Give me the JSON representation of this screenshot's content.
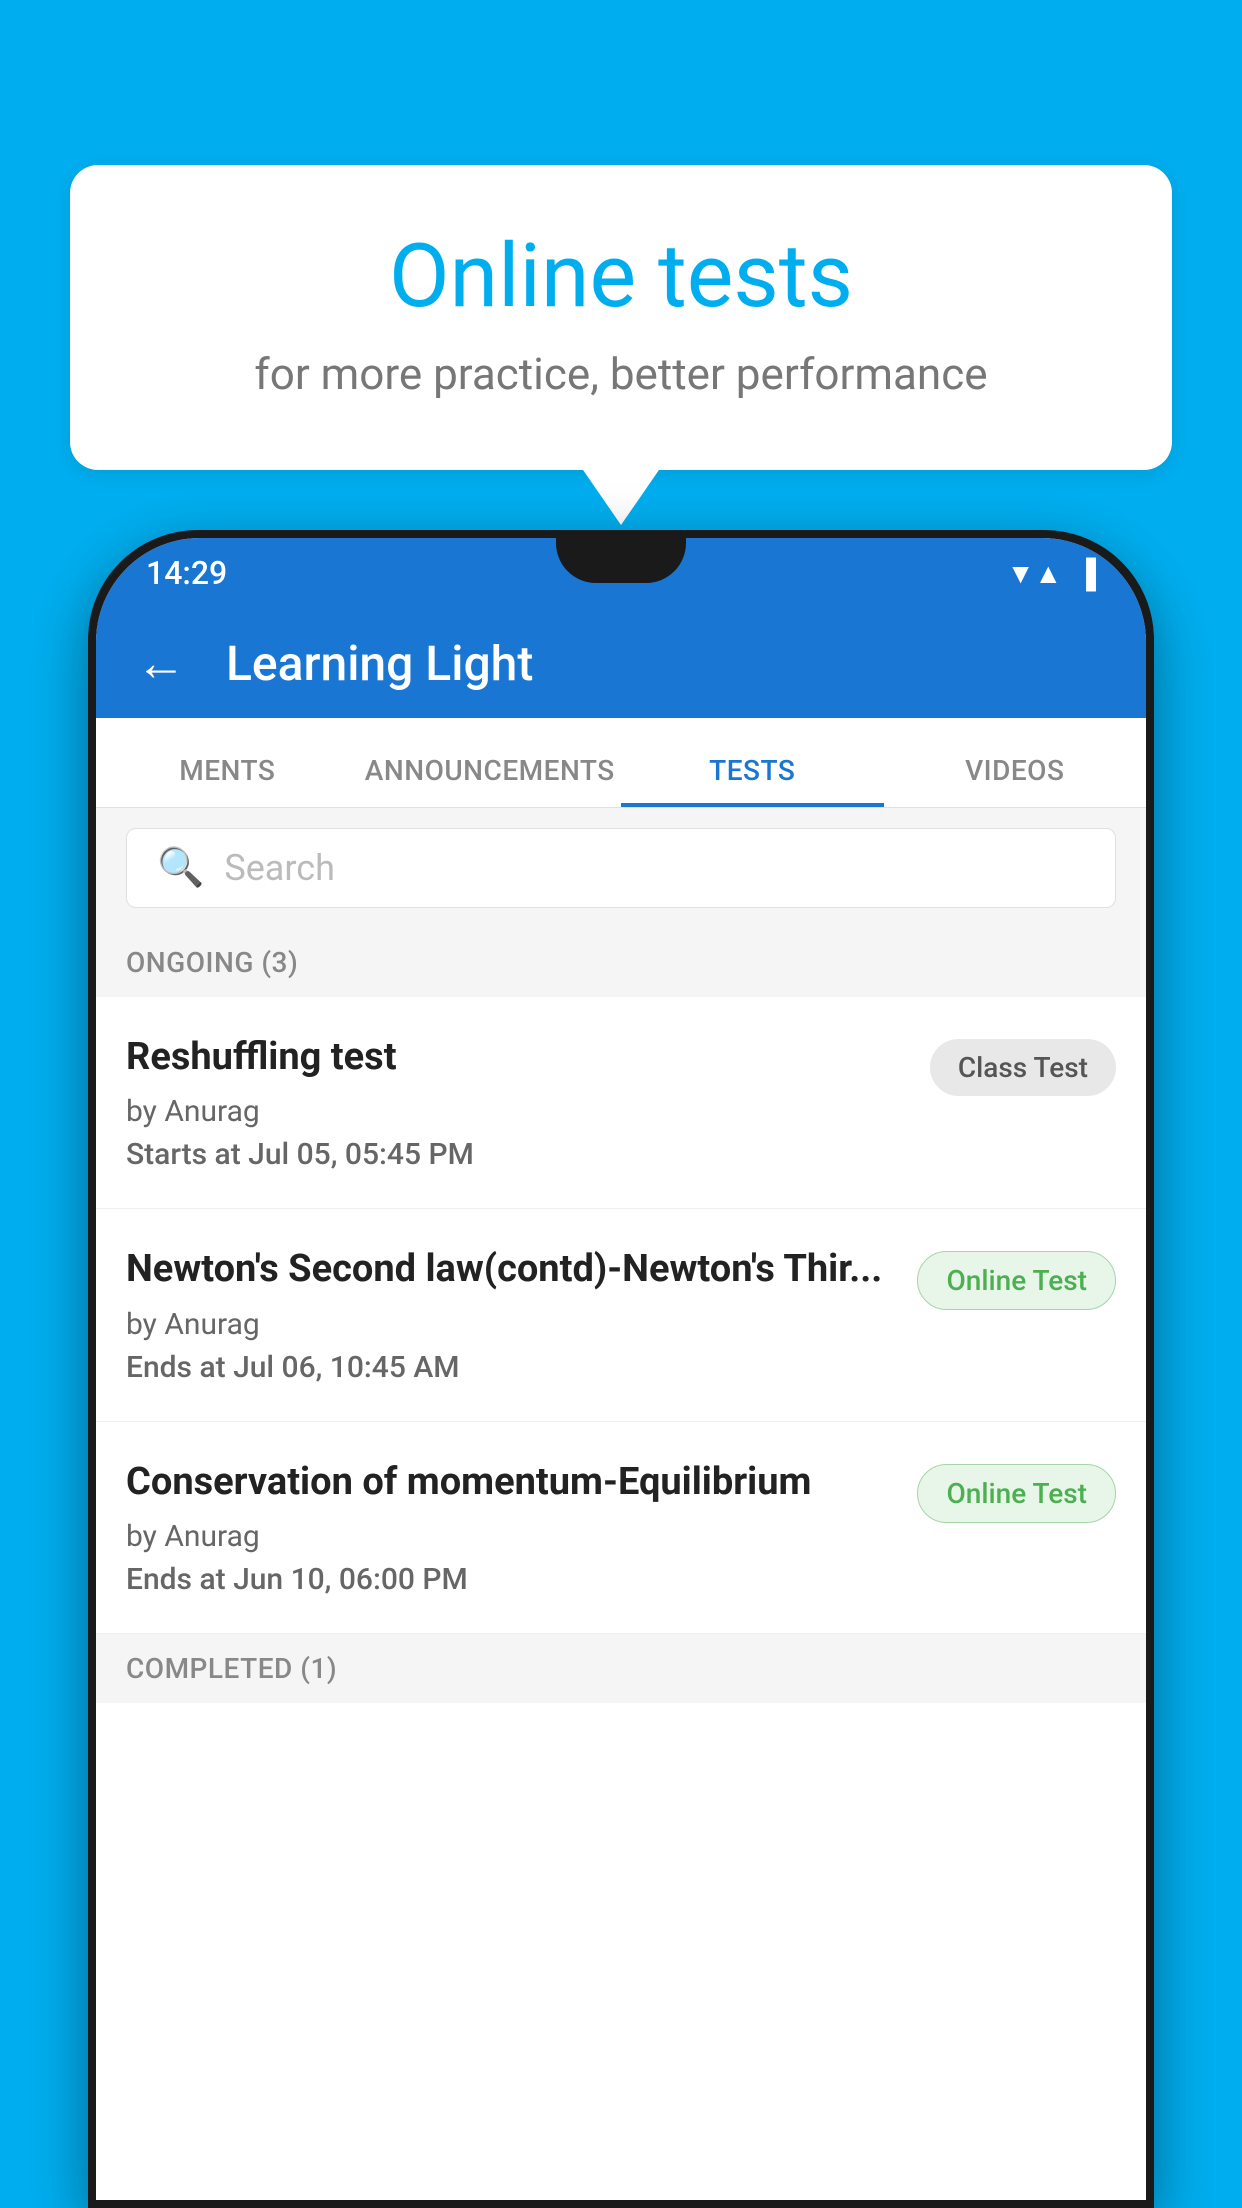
{
  "background_color": "#00AEEF",
  "bubble": {
    "title": "Online tests",
    "subtitle": "for more practice, better performance"
  },
  "status_bar": {
    "time": "14:29",
    "wifi": "▼",
    "signal": "▲",
    "battery": "▐"
  },
  "app_bar": {
    "title": "Learning Light",
    "back_label": "←"
  },
  "tabs": [
    {
      "id": "ments",
      "label": "MENTS",
      "active": false
    },
    {
      "id": "announcements",
      "label": "ANNOUNCEMENTS",
      "active": false
    },
    {
      "id": "tests",
      "label": "TESTS",
      "active": true
    },
    {
      "id": "videos",
      "label": "VIDEOS",
      "active": false
    }
  ],
  "search": {
    "placeholder": "Search"
  },
  "ongoing_section": {
    "label": "ONGOING (3)"
  },
  "tests": [
    {
      "id": "test-1",
      "name": "Reshuffling test",
      "author": "by Anurag",
      "time_label": "Starts at",
      "time_value": "Jul 05, 05:45 PM",
      "badge": "Class Test",
      "badge_type": "class"
    },
    {
      "id": "test-2",
      "name": "Newton's Second law(contd)-Newton's Thir...",
      "author": "by Anurag",
      "time_label": "Ends at",
      "time_value": "Jul 06, 10:45 AM",
      "badge": "Online Test",
      "badge_type": "online"
    },
    {
      "id": "test-3",
      "name": "Conservation of momentum-Equilibrium",
      "author": "by Anurag",
      "time_label": "Ends at",
      "time_value": "Jun 10, 06:00 PM",
      "badge": "Online Test",
      "badge_type": "online"
    }
  ],
  "completed_section": {
    "label": "COMPLETED (1)"
  }
}
